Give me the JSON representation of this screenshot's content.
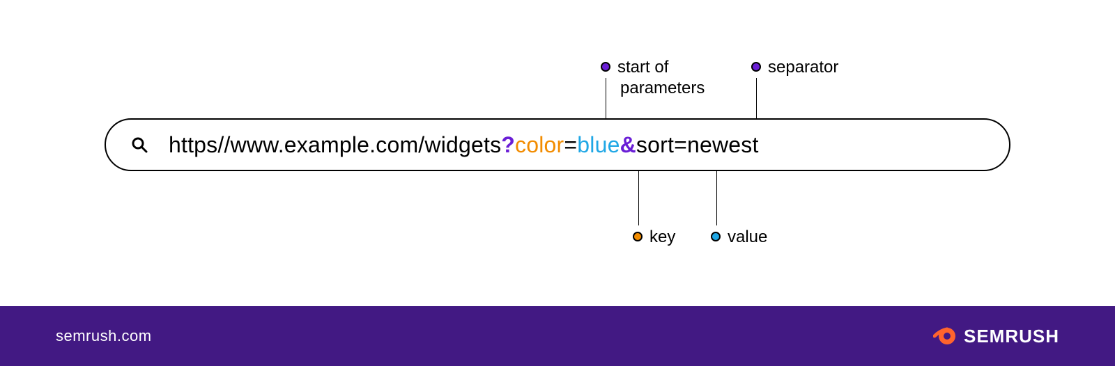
{
  "url": {
    "base": "https//www.example.com/widgets",
    "qmark": "?",
    "key1": "color",
    "eq1": "=",
    "val1": "blue",
    "amp": "&",
    "rest": "sort=newest"
  },
  "annotations": {
    "start_line1": "start of",
    "start_line2": "parameters",
    "separator": "separator",
    "key": "key",
    "value": "value"
  },
  "footer": {
    "site": "semrush.com",
    "brand": "SEMRUSH"
  },
  "colors": {
    "purple": "#6A1ED6",
    "orange": "#F28C00",
    "blue": "#1FA7E5",
    "footer_bg": "#421983",
    "brand_orange": "#FF642D"
  }
}
